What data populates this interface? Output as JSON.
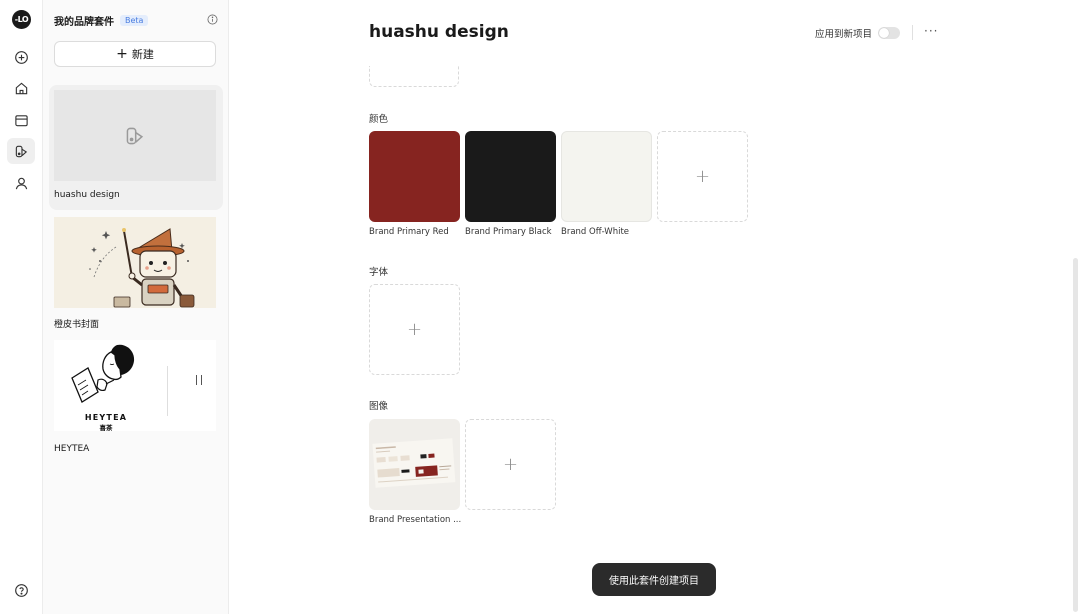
{
  "rail": {
    "logo_text": "-LO",
    "items": [
      {
        "icon": "plus-circle-icon"
      },
      {
        "icon": "home-icon"
      },
      {
        "icon": "folder-icon"
      },
      {
        "icon": "brand-kit-icon",
        "active": true
      },
      {
        "icon": "user-icon"
      }
    ],
    "help_icon": "help-icon"
  },
  "panel": {
    "title": "我的品牌套件",
    "beta": "Beta",
    "new_label": "新建",
    "kits": [
      {
        "name": "huashu design",
        "selected": true
      },
      {
        "name": "橙皮书封面"
      },
      {
        "name": "HEYTEA",
        "logo_text": "HEYTEA",
        "logo_sub": "喜茶"
      }
    ]
  },
  "main": {
    "title": "huashu design",
    "apply_label": "应用到新项目",
    "more_label": "···",
    "colors_label": "颜色",
    "colors": [
      {
        "name": "Brand Primary Red",
        "hex": "#862420"
      },
      {
        "name": "Brand Primary Black",
        "hex": "#1a1a1a"
      },
      {
        "name": "Brand Off-White",
        "hex": "#f4f4ef"
      }
    ],
    "fonts_label": "字体",
    "images_label": "图像",
    "images": [
      {
        "name": "Brand Presentation ..."
      }
    ],
    "add_symbol": "+",
    "cta_label": "使用此套件创建项目"
  }
}
